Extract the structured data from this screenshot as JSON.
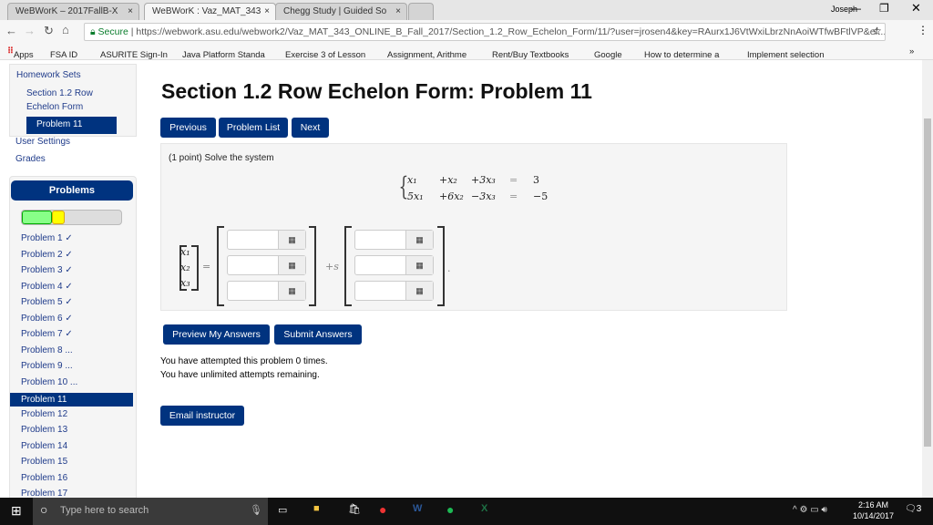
{
  "browser": {
    "tabs": [
      {
        "label": "WeBWorK – 2017FallB-X"
      },
      {
        "label": "WeBWorK : Vaz_MAT_343"
      },
      {
        "label": "Chegg Study | Guided So"
      }
    ],
    "user": "Joseph",
    "secure": "Secure",
    "url": "https://webwork.asu.edu/webwork2/Vaz_MAT_343_ONLINE_B_Fall_2017/Section_1.2_Row_Echelon_Form/11/?user=jrosen4&key=RAurx1J6VtWxiLbrzNnAoiWTfwBFtlVP&ef...",
    "bookmarks": [
      "Apps",
      "FSA ID",
      "ASURITE Sign-In",
      "Java Platform Standa",
      "Exercise 3 of Lesson",
      "Assignment, Arithme",
      "Rent/Buy Textbooks",
      "Google",
      "How to determine a",
      "Implement selection"
    ]
  },
  "nav": {
    "homework_sets": "Homework Sets",
    "set": "Section 1.2 Row Echelon Form",
    "set_line1": "Section 1.2 Row",
    "set_line2": "Echelon Form",
    "current": "Problem 11",
    "user_settings": "User Settings",
    "grades": "Grades"
  },
  "problems": {
    "title": "Problems",
    "progress": {
      "correct_fraction": 0.3,
      "partial_fraction": 0.13,
      "correct_color": "#88ff88",
      "partial_color": "#ffff00"
    },
    "items": [
      "Problem 1 ✓",
      "Problem 2 ✓",
      "Problem 3 ✓",
      "Problem 4 ✓",
      "Problem 5 ✓",
      "Problem 6 ✓",
      "Problem 7 ✓",
      "Problem 8 ...",
      "Problem 9 ...",
      "Problem 10 ...",
      "Problem 11",
      "Problem 12",
      "Problem 13",
      "Problem 14",
      "Problem 15",
      "Problem 16",
      "Problem 17"
    ],
    "active_index": 10
  },
  "main": {
    "title": "Section 1.2 Row Echelon Form: Problem 11",
    "previous": "Previous",
    "problem_list": "Problem List",
    "next": "Next",
    "prompt": "(1 point) Solve the system",
    "system": [
      [
        "x₁",
        "+x₂",
        "+3x₃",
        "=",
        "3"
      ],
      [
        "5x₁",
        "+6x₂",
        "−3x₃",
        "=",
        "−5"
      ]
    ],
    "lhs": [
      "x₁",
      "x₂",
      "x₃"
    ],
    "equals": "=",
    "plus_s": "+s",
    "period": ".",
    "keypad_icon": "▦",
    "preview": "Preview My Answers",
    "submit": "Submit Answers",
    "attempted": "You have attempted this problem 0 times.",
    "remaining": "You have unlimited attempts remaining.",
    "email": "Email instructor"
  },
  "taskbar": {
    "search_placeholder": "Type here to search",
    "time": "2:16 AM",
    "date": "10/14/2017",
    "notifications": "3"
  }
}
